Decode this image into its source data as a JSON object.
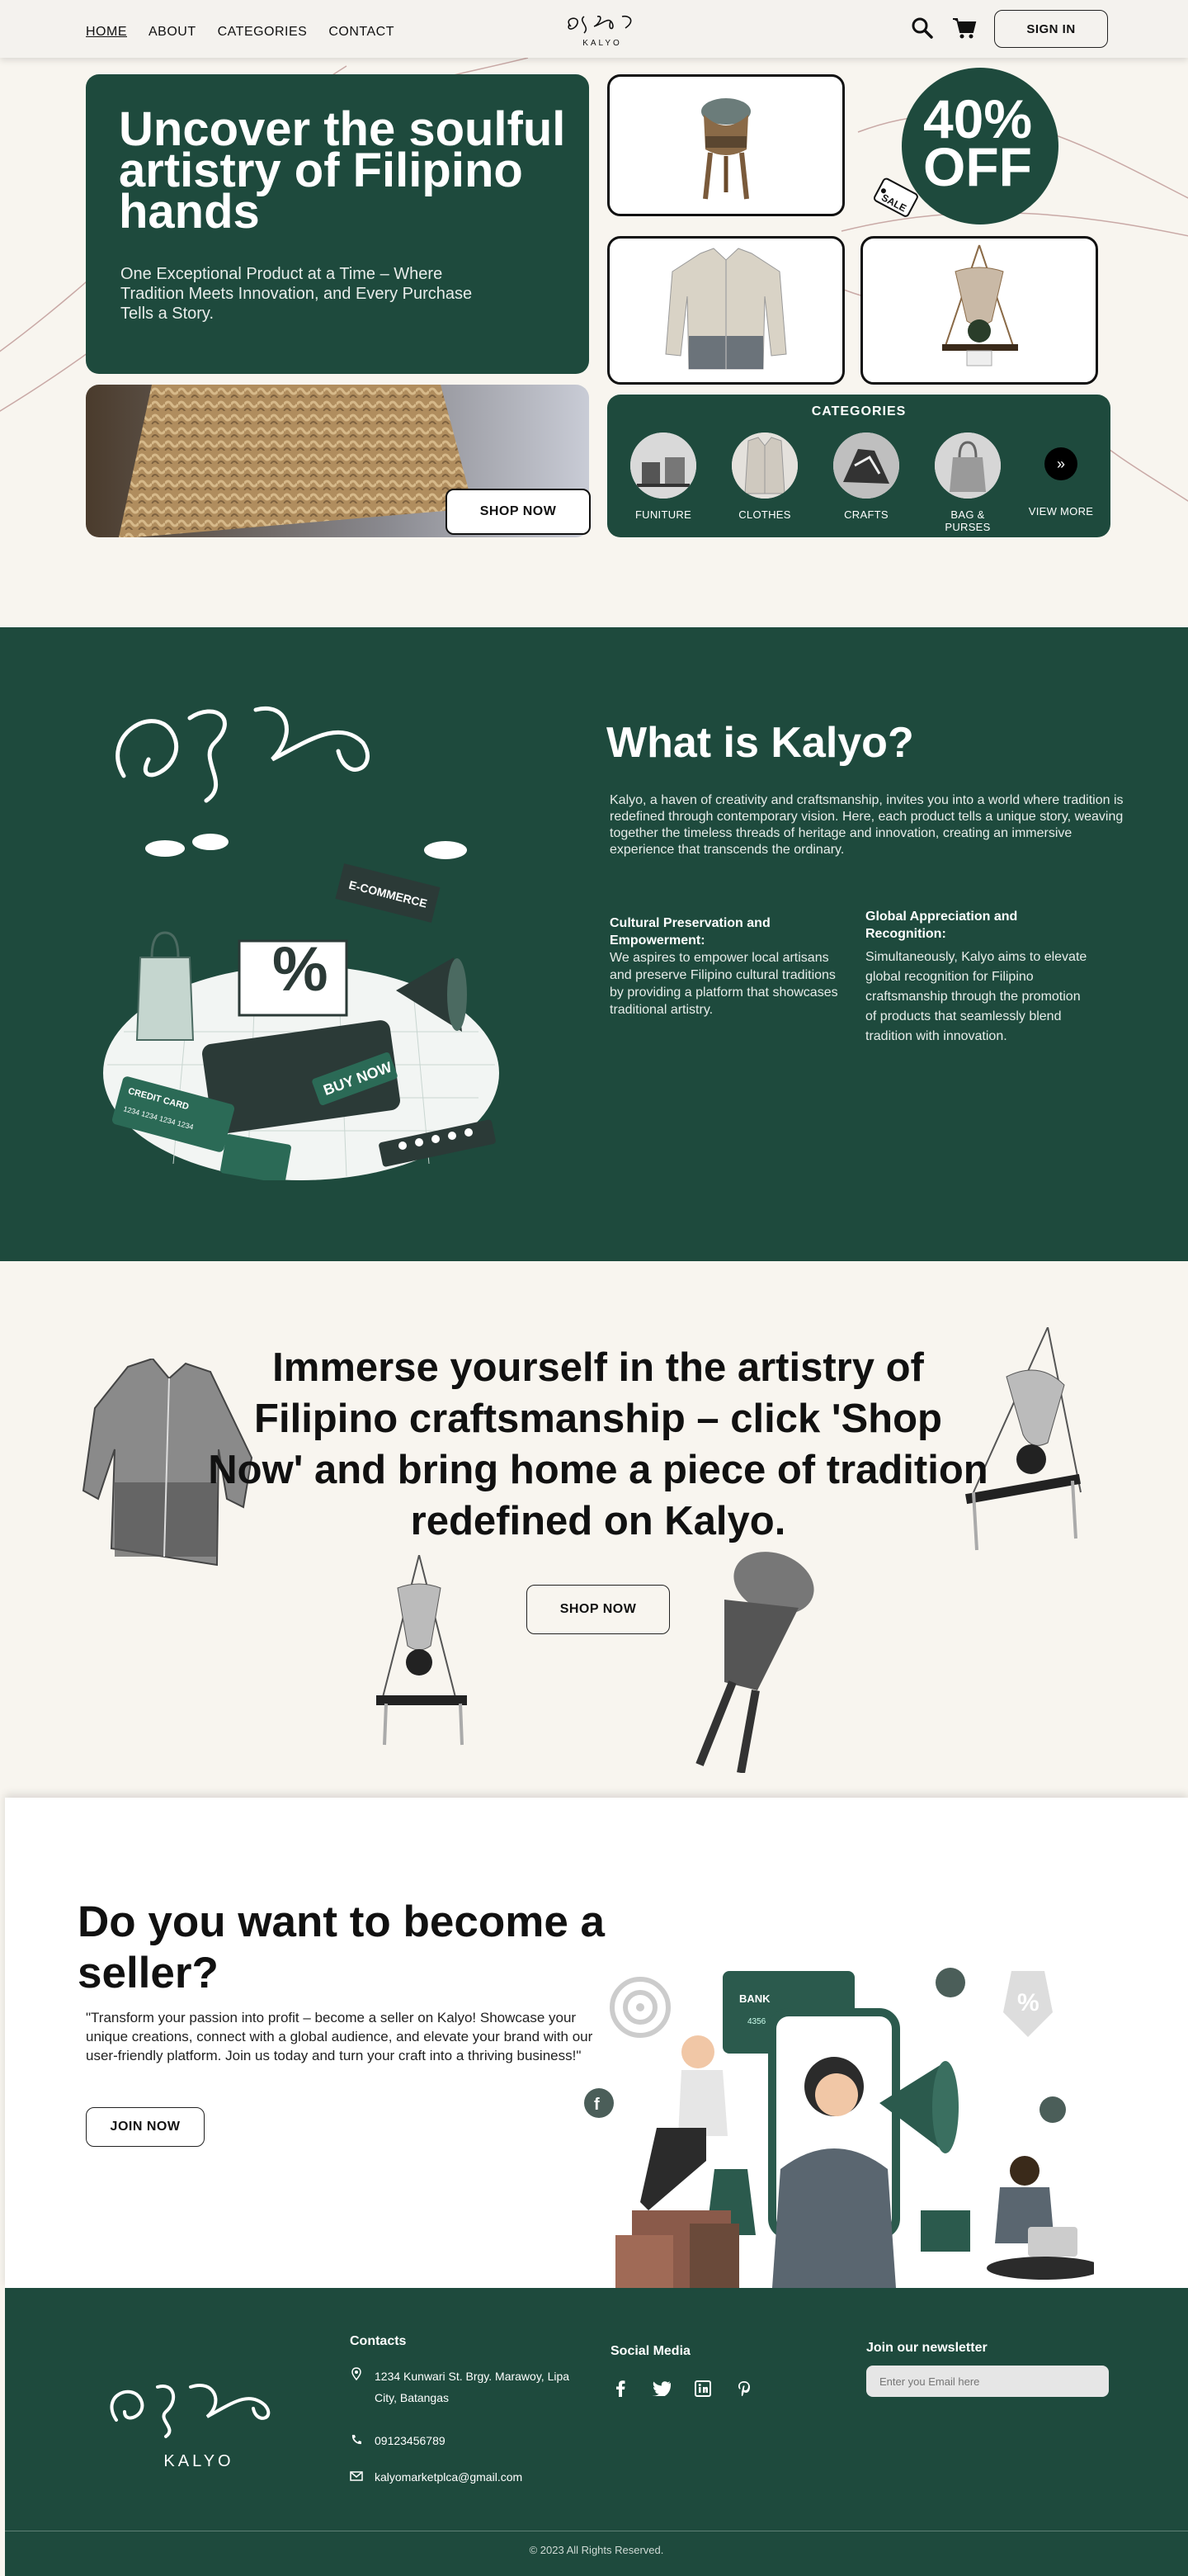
{
  "nav": {
    "links": [
      "HOME",
      "ABOUT",
      "CATEGORIES",
      "CONTACT"
    ],
    "logo_text": "KALYO",
    "signin_label": "SIGN IN"
  },
  "hero": {
    "title": "Uncover the soulful artistry of Filipino hands",
    "subtitle": "One Exceptional Product at a Time – Where Tradition Meets Innovation, and Every Purchase Tells a Story.",
    "shop_now_label": "SHOP NOW",
    "sale_text": "40% OFF",
    "sale_tag": "SALE"
  },
  "categories": {
    "title": "CATEGORIES",
    "items": [
      {
        "label": "FUNITURE"
      },
      {
        "label": "CLOTHES"
      },
      {
        "label": "CRAFTS"
      },
      {
        "label": "BAG & PURSES"
      },
      {
        "label": "VIEW MORE"
      }
    ]
  },
  "about": {
    "title": "What is Kalyo?",
    "body": "Kalyo, a haven of creativity and craftsmanship, invites you into a world where tradition is redefined through contemporary vision. Here, each product tells a unique story, weaving together the timeless threads of heritage and innovation, creating an immersive experience that transcends the ordinary.",
    "col1_title": "Cultural Preservation and Empowerment:",
    "col1_text": "We aspires to empower local artisans and preserve Filipino cultural traditions by providing a platform that showcases traditional artistry.",
    "col2_title": "Global Appreciation and Recognition:",
    "col2_text": "Simultaneously, Kalyo aims to elevate global recognition for Filipino craftsmanship through the promotion of products that seamlessly blend tradition with innovation.",
    "illus": {
      "ecommerce": "E-COMMERCE",
      "percent": "%",
      "buy_now": "BUY NOW",
      "credit_card": "CREDIT CARD",
      "card_number": "1234 1234 1234 1234"
    }
  },
  "immerse": {
    "title": "Immerse yourself in the artistry of Filipino craftsmanship – click 'Shop Now' and bring home a piece of tradition redefined on Kalyo.",
    "button_label": "SHOP NOW"
  },
  "seller": {
    "title": "Do you want to become a seller?",
    "text": "\"Transform your passion into profit – become a seller on Kalyo! Showcase your unique creations, connect with a global audience, and elevate your brand with our user-friendly platform. Join us today and turn your craft into a thriving business!\"",
    "button_label": "JOIN NOW",
    "illus": {
      "bank": "BANK",
      "card_number": "4356",
      "percent": "%"
    }
  },
  "footer": {
    "logo_text": "KALYO",
    "contacts_title": "Contacts",
    "address": "1234 Kunwari St. Brgy. Marawoy, Lipa City, Batangas",
    "phone": "09123456789",
    "email": "kalyomarketplca@gmail.com",
    "social_title": "Social Media",
    "social_icons": [
      "facebook-icon",
      "twitter-icon",
      "linkedin-icon",
      "pinterest-icon"
    ],
    "newsletter_title": "Join our newsletter",
    "newsletter_placeholder": "Enter you Email here",
    "copyright": "© 2023 All Rights Reserved."
  },
  "colors": {
    "primary": "#1e4a3d",
    "background": "#f8f5ef"
  }
}
